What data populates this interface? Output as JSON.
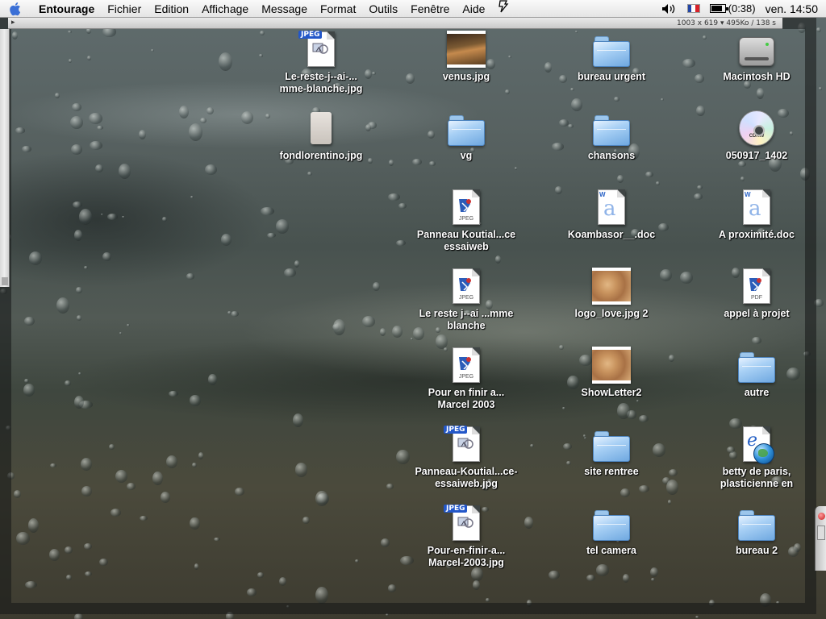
{
  "menubar": {
    "apple_icon": "apple-icon",
    "items": [
      "Entourage",
      "Fichier",
      "Edition",
      "Affichage",
      "Message",
      "Format",
      "Outils",
      "Fenêtre",
      "Aide"
    ],
    "script_icon": "script-icon",
    "volume_icon": "speaker-icon",
    "input_flag_icon": "french-flag-icon",
    "battery_label": "(0:38)",
    "battery_level_percent": 85,
    "clock": "ven. 14:50"
  },
  "window": {
    "info_text": "1003 x 619 ▾  495Ko / 138 s"
  },
  "desktop": {
    "icons": [
      {
        "label": "Le-reste-j--ai-...\nmme-blanche.jpg",
        "kind": "jpeg-doc"
      },
      {
        "label": "venus.jpg",
        "kind": "thumb-venus"
      },
      {
        "label": "bureau urgent",
        "kind": "folder"
      },
      {
        "label": "Macintosh HD",
        "kind": "hard-disk"
      },
      {
        "label": "fondlorentino.jpg",
        "kind": "pale-file"
      },
      {
        "label": "vg",
        "kind": "folder"
      },
      {
        "label": "chansons",
        "kind": "folder"
      },
      {
        "label": "050917_1402",
        "kind": "cd"
      },
      {
        "label": "Panneau Koutial...ce\nessaiweb",
        "kind": "jpeg-preview"
      },
      {
        "label": "Koambasor__.doc",
        "kind": "word-doc"
      },
      {
        "label": "A proximité.doc",
        "kind": "word-doc"
      },
      {
        "label": "Le reste j--ai ...mme\nblanche",
        "kind": "jpeg-preview"
      },
      {
        "label": "logo_love.jpg 2",
        "kind": "thumb-love"
      },
      {
        "label": "appel à projet",
        "kind": "pdf-preview"
      },
      {
        "label": "Pour en finir a...\nMarcel 2003",
        "kind": "jpeg-preview"
      },
      {
        "label": "ShowLetter2",
        "kind": "thumb-love"
      },
      {
        "label": "autre",
        "kind": "folder"
      },
      {
        "label": "Panneau-Koutial...ce-\nessaiweb.jpg",
        "kind": "jpeg-doc"
      },
      {
        "label": "site rentree",
        "kind": "folder"
      },
      {
        "label": "betty de paris,\nplasticienne en",
        "kind": "ie-doc"
      },
      {
        "label": "Pour-en-finir-a...\nMarcel-2003.jpg",
        "kind": "jpeg-doc"
      },
      {
        "label": "tel camera",
        "kind": "folder"
      },
      {
        "label": "bureau 2",
        "kind": "folder"
      }
    ],
    "jpeg_badge": "JPEG",
    "jpeg_sub": "JPEG",
    "pdf_sub": "PDF",
    "cd_text": "CDRW",
    "word_badge": "W",
    "word_letter": "a",
    "ie_letter": "e"
  }
}
